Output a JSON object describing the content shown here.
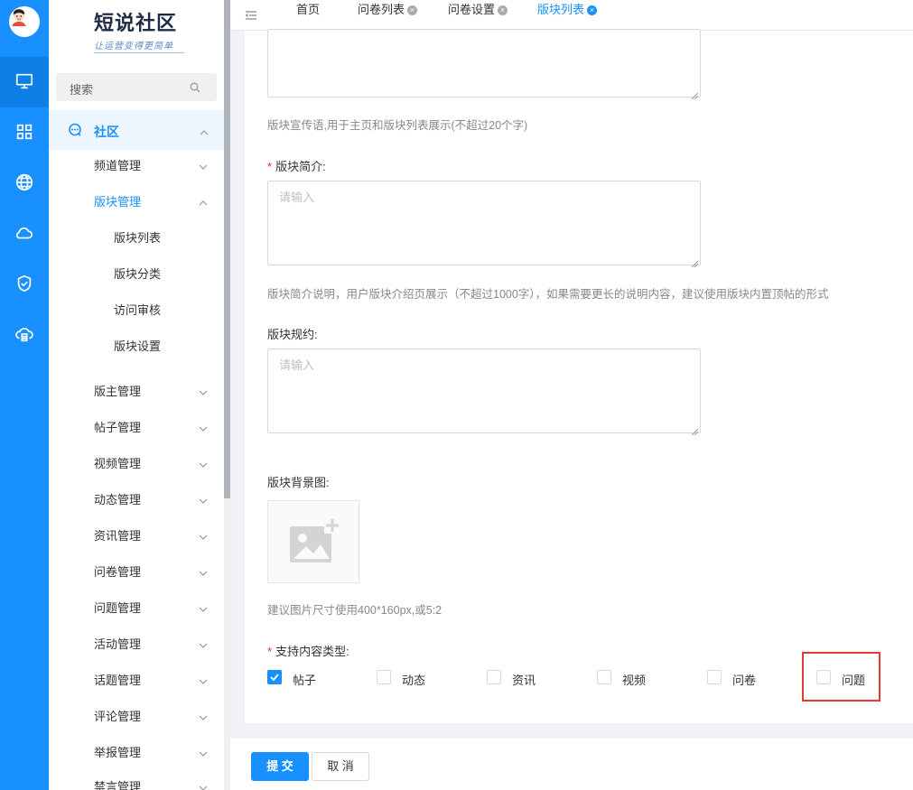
{
  "rail": {
    "items": [
      {
        "icon": "desktop-icon"
      },
      {
        "icon": "grid-icon"
      },
      {
        "icon": "globe-icon"
      },
      {
        "icon": "cloud-icon"
      },
      {
        "icon": "shield-check-icon"
      },
      {
        "icon": "cloud-server-icon"
      }
    ]
  },
  "brand": {
    "title": "短说社区",
    "tagline": "让运营变得更简单"
  },
  "search": {
    "placeholder": "搜索"
  },
  "sidebar": {
    "group_label": "社区",
    "items": [
      {
        "label": "频道管理"
      },
      {
        "label": "版块管理"
      },
      {
        "label": "版主管理"
      },
      {
        "label": "帖子管理"
      },
      {
        "label": "视频管理"
      },
      {
        "label": "动态管理"
      },
      {
        "label": "资讯管理"
      },
      {
        "label": "问卷管理"
      },
      {
        "label": "问题管理"
      },
      {
        "label": "活动管理"
      },
      {
        "label": "话题管理"
      },
      {
        "label": "评论管理"
      },
      {
        "label": "举报管理"
      },
      {
        "label": "禁言管理"
      }
    ],
    "sub_items": [
      {
        "label": "版块列表"
      },
      {
        "label": "版块分类"
      },
      {
        "label": "访问审核"
      },
      {
        "label": "版块设置"
      }
    ]
  },
  "tabs": [
    {
      "label": "首页"
    },
    {
      "label": "问卷列表"
    },
    {
      "label": "问卷设置"
    },
    {
      "label": "版块列表"
    }
  ],
  "form": {
    "slogan_help": "版块宣传语,用于主页和版块列表展示(不超过20个字)",
    "intro_label": "版块简介:",
    "intro_placeholder": "请输入",
    "intro_help": "版块简介说明，用户版块介绍页展示（不超过1000字），如果需要更长的说明内容，建议使用版块内置顶帖的形式",
    "rules_label": "版块规约:",
    "rules_placeholder": "请输入",
    "bg_label": "版块背景图:",
    "bg_help": "建议图片尺寸使用400*160px,或5:2",
    "types_label": "支持内容类型:",
    "types": [
      {
        "label": "帖子",
        "checked": true
      },
      {
        "label": "动态",
        "checked": false
      },
      {
        "label": "资讯",
        "checked": false
      },
      {
        "label": "视频",
        "checked": false
      },
      {
        "label": "问卷",
        "checked": false
      },
      {
        "label": "问题",
        "checked": false
      }
    ]
  },
  "footer": {
    "submit": "提 交",
    "cancel": "取 消"
  },
  "colors": {
    "accent": "#1890ff",
    "highlight": "#e53935",
    "required": "#f5222d"
  }
}
